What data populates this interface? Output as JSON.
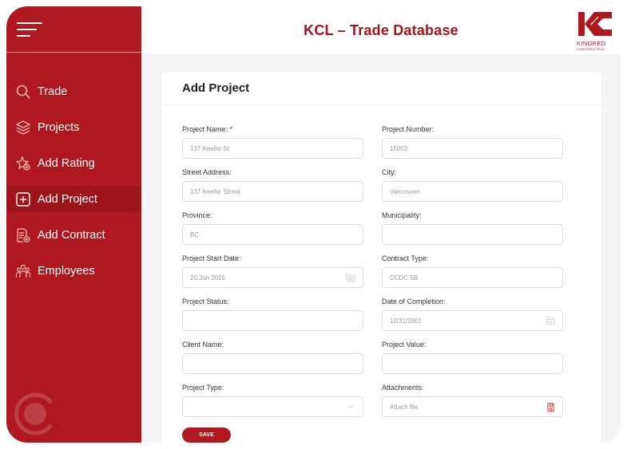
{
  "header": {
    "title": "KCL – Trade Database"
  },
  "logo": {
    "line1": "KINDRED",
    "line2": "CONSTRUCTION"
  },
  "colors": {
    "brand": "#b0181f",
    "active_nav": "#9d141b",
    "title": "#a5141c"
  },
  "sidebar": {
    "items": [
      {
        "label": "Trade",
        "icon": "search-icon",
        "active": false
      },
      {
        "label": "Projects",
        "icon": "layers-icon",
        "active": false
      },
      {
        "label": "Add Rating",
        "icon": "star-plus-icon",
        "active": false
      },
      {
        "label": "Add Project",
        "icon": "plus-square-icon",
        "active": true
      },
      {
        "label": "Add Contract",
        "icon": "document-plus-icon",
        "active": false
      },
      {
        "label": "Employees",
        "icon": "people-icon",
        "active": false
      }
    ]
  },
  "form": {
    "title": "Add Project",
    "fields": {
      "project_name": {
        "label": "Project Name: *",
        "value": "137 Keefer St"
      },
      "project_number": {
        "label": "Project Number:",
        "value": "15003"
      },
      "street_address": {
        "label": "Street Address:",
        "value": "137 Keefer Street"
      },
      "city": {
        "label": "City:",
        "value": "Vancouver"
      },
      "province": {
        "label": "Province:",
        "value": "BC"
      },
      "municipality": {
        "label": "Municipality:",
        "value": ""
      },
      "project_start_date": {
        "label": "Project Start Date:",
        "value": "20 Jun 2015"
      },
      "contract_type": {
        "label": "Contract Type:",
        "value": "CCDC 5B"
      },
      "project_status": {
        "label": "Project Status:",
        "value": ""
      },
      "date_of_completion": {
        "label": "Date of Completion:",
        "value": "12/31/2001"
      },
      "client_name": {
        "label": "Client Name:",
        "value": ""
      },
      "project_value": {
        "label": "Project Value:",
        "value": ""
      },
      "project_type": {
        "label": "Project Type:",
        "value": ""
      },
      "attachments": {
        "label": "Attachments:",
        "placeholder": "Attach file"
      }
    },
    "save_label": "SAVE"
  }
}
